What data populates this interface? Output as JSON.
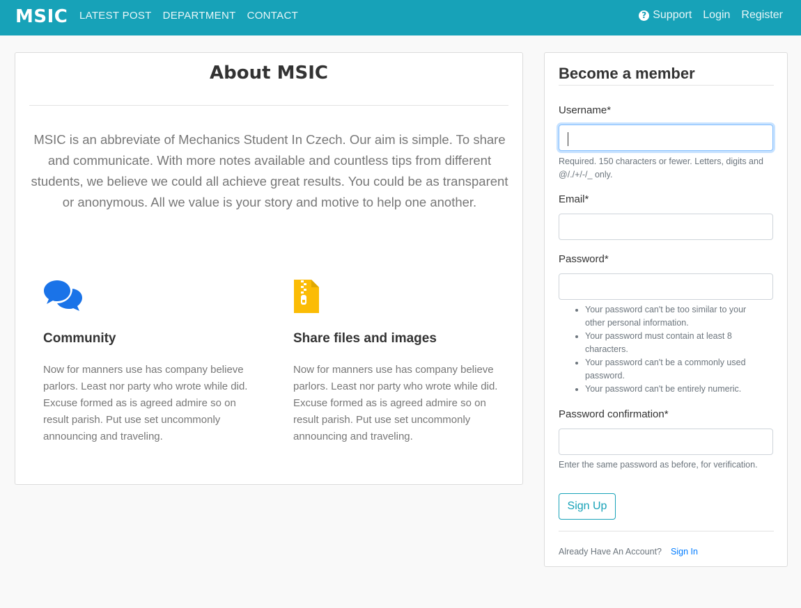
{
  "navbar": {
    "brand": "MSIC",
    "left_links": [
      "LATEST POST",
      "DEPARTMENT",
      "CONTACT"
    ],
    "support_label": "Support",
    "login_label": "Login",
    "register_label": "Register"
  },
  "about": {
    "title": "About MSIC",
    "text": "MSIC is an abbreviate of Mechanics Student In Czech. Our aim is simple. To share and communicate. With more notes available and countless tips from different students, we believe we could all achieve great results. You could be as transparent or anonymous. All we value is your story and motive to help one another.",
    "features": [
      {
        "icon": "comments-icon",
        "title": "Community",
        "text": "Now for manners use has company believe parlors. Least nor party who wrote while did. Excuse formed as is agreed admire so on result parish. Put use set uncommonly announcing and traveling."
      },
      {
        "icon": "file-archive-icon",
        "title": "Share files and images",
        "text": "Now for manners use has company believe parlors. Least nor party who wrote while did. Excuse formed as is agreed admire so on result parish. Put use set uncommonly announcing and traveling."
      }
    ]
  },
  "signup": {
    "title": "Become a member",
    "username_label": "Username*",
    "username_value": "",
    "username_help": "Required. 150 characters or fewer. Letters, digits and @/./+/-/_ only.",
    "email_label": "Email*",
    "email_value": "",
    "password_label": "Password*",
    "password_value": "",
    "password_rules": [
      "Your password can't be too similar to your other personal information.",
      "Your password must contain at least 8 characters.",
      "Your password can't be a commonly used password.",
      "Your password can't be entirely numeric."
    ],
    "password_confirm_label": "Password confirmation*",
    "password_confirm_value": "",
    "password_confirm_help": "Enter the same password as before, for verification.",
    "submit_label": "Sign Up",
    "already_text": "Already Have An Account?",
    "signin_label": "Sign In"
  },
  "colors": {
    "navbar": "#17a2b8",
    "comments_icon": "#1a73e8",
    "file_icon": "#fbbc05",
    "link": "#007bff"
  }
}
